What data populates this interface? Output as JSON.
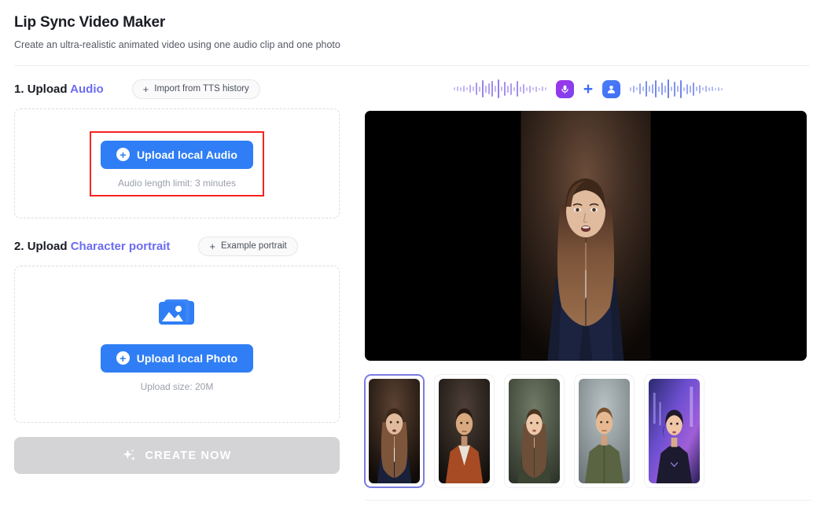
{
  "header": {
    "title": "Lip Sync Video Maker",
    "subtitle": "Create an ultra-realistic animated video using one audio clip and one photo"
  },
  "steps": {
    "audio": {
      "number": "1.",
      "label": "Upload",
      "highlight": "Audio",
      "action_button": {
        "label": "Import from TTS history",
        "plus": "+"
      },
      "upload_button": {
        "label": "Upload local Audio",
        "icon": "plus-circle-icon"
      },
      "hint": "Audio length limit: 3 minutes",
      "highlighted": true
    },
    "portrait": {
      "number": "2.",
      "label": "Upload",
      "highlight": "Character portrait",
      "action_button": {
        "label": "Example portrait",
        "plus": "+"
      },
      "upload_button": {
        "label": "Upload local Photo",
        "icon": "plus-circle-icon"
      },
      "hint": "Upload size: 20M",
      "placeholder_icon": "photo-stack-icon"
    }
  },
  "create": {
    "label": "CREATE NOW",
    "icon": "sparkle-icon",
    "enabled": false
  },
  "preview": {
    "banner": {
      "left_wave": "audio-waveform",
      "mic_icon": "microphone-icon",
      "plus": "+",
      "person_icon": "person-icon",
      "right_wave": "audio-waveform"
    },
    "portraits": [
      {
        "name": "woman-navy-suit",
        "selected": true
      },
      {
        "name": "man-rust-jacket",
        "selected": false
      },
      {
        "name": "woman-green-turtleneck",
        "selected": false
      },
      {
        "name": "man-olive-shirt",
        "selected": false
      },
      {
        "name": "woman-cyberpunk",
        "selected": false
      }
    ]
  },
  "colors": {
    "primary": "#2f7ef5",
    "accent": "#6b6cf3",
    "highlight_box": "#f5241f",
    "disabled": "#d4d4d6",
    "selection": "#7b7ce0"
  }
}
